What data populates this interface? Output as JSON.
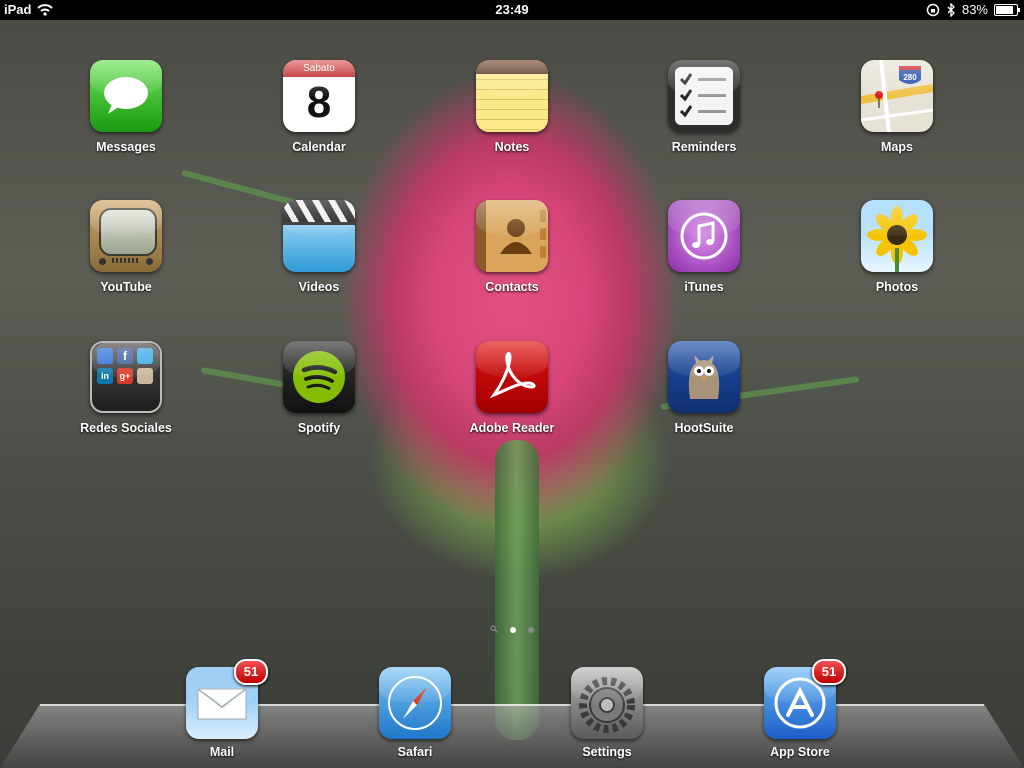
{
  "statusbar": {
    "device": "iPad",
    "time": "23:49",
    "battery": "83%",
    "battery_level": 0.83
  },
  "apps": [
    {
      "name": "Messages"
    },
    {
      "name": "Calendar",
      "day": "Sabato",
      "date": "8"
    },
    {
      "name": "Notes"
    },
    {
      "name": "Reminders"
    },
    {
      "name": "Maps",
      "shield": "280"
    },
    {
      "name": "YouTube"
    },
    {
      "name": "Videos"
    },
    {
      "name": "Contacts"
    },
    {
      "name": "iTunes"
    },
    {
      "name": "Photos"
    },
    {
      "name": "Redes Sociales"
    },
    {
      "name": "Spotify"
    },
    {
      "name": "Adobe Reader"
    },
    {
      "name": "HootSuite"
    }
  ],
  "dock": [
    {
      "name": "Mail",
      "badge": "51"
    },
    {
      "name": "Safari"
    },
    {
      "name": "Settings"
    },
    {
      "name": "App Store",
      "badge": "51"
    }
  ],
  "page_indicator": {
    "pages": 2,
    "current": 1
  },
  "colors": {
    "badge_red": "#d40000",
    "status_bar": "#000000",
    "label": "#ffffff"
  }
}
